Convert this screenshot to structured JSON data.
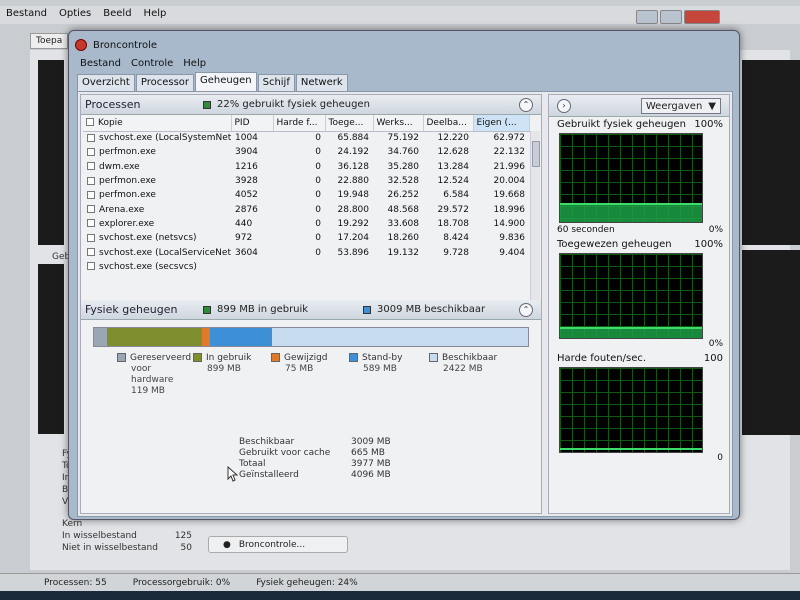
{
  "bg": {
    "menu": [
      "Bestand",
      "Opties",
      "Beeld",
      "Help"
    ],
    "tab_label": "Toepa",
    "graph_label": "Gebr",
    "left_labels": [
      "Fysi",
      "Tota",
      "In c",
      "Besc",
      "Vrij",
      "Kern"
    ],
    "rows": [
      {
        "k": "In wisselbestand",
        "v": "125"
      },
      {
        "k": "Niet in wisselbestand",
        "v": "50"
      }
    ],
    "rm_button": "Broncontrole...",
    "status": [
      "Processen: 55",
      "Processorgebruik: 0%",
      "Fysiek geheugen: 24%"
    ]
  },
  "rm": {
    "title": "Broncontrole",
    "menu": [
      "Bestand",
      "Controle",
      "Help"
    ],
    "tabs": [
      "Overzicht",
      "Processor",
      "Geheugen",
      "Schijf",
      "Netwerk"
    ],
    "active_tab": "Geheugen",
    "processes": {
      "title": "Processen",
      "badge": "22% gebruikt fysiek geheugen",
      "badge_color": "#2e8b3a",
      "columns": [
        "Kopie",
        "PID",
        "Harde f...",
        "Toege...",
        "Werks...",
        "Deelba...",
        "Eigen (..."
      ],
      "rows": [
        [
          "svchost.exe (LocalSystemNet...",
          "1004",
          "0",
          "65.884",
          "75.192",
          "12.220",
          "62.972"
        ],
        [
          "perfmon.exe",
          "3904",
          "0",
          "24.192",
          "34.760",
          "12.628",
          "22.132"
        ],
        [
          "dwm.exe",
          "1216",
          "0",
          "36.128",
          "35.280",
          "13.284",
          "21.996"
        ],
        [
          "perfmon.exe",
          "3928",
          "0",
          "22.880",
          "32.528",
          "12.524",
          "20.004"
        ],
        [
          "perfmon.exe",
          "4052",
          "0",
          "19.948",
          "26.252",
          "6.584",
          "19.668"
        ],
        [
          "Arena.exe",
          "2876",
          "0",
          "28.800",
          "48.568",
          "29.572",
          "18.996"
        ],
        [
          "explorer.exe",
          "440",
          "0",
          "19.292",
          "33.608",
          "18.708",
          "14.900"
        ],
        [
          "svchost.exe (netsvcs)",
          "972",
          "0",
          "17.204",
          "18.260",
          "8.424",
          "9.836"
        ],
        [
          "svchost.exe (LocalServiceNet...",
          "3604",
          "0",
          "53.896",
          "19.132",
          "9.728",
          "9.404"
        ],
        [
          "svchost.exe (secsvcs)",
          "",
          "",
          "",
          "",
          "",
          ""
        ]
      ]
    },
    "physical": {
      "title": "Fysiek geheugen",
      "in_use_badge": "899 MB in gebruik",
      "available_badge": "3009 MB beschikbaar",
      "bar_mb": {
        "reserved": 119,
        "in_use": 899,
        "modified": 75,
        "standby": 589,
        "free": 2422
      },
      "legend": [
        {
          "label": "Gereserveerd voor hardware",
          "lines": [
            "Gereserveerd",
            "voor",
            "hardware"
          ],
          "value": "119 MB",
          "color": "#9aa6b4"
        },
        {
          "label": "In gebruik",
          "lines": [
            "In gebruik"
          ],
          "value": "899 MB",
          "color": "#7f8f2f"
        },
        {
          "label": "Gewijzigd",
          "lines": [
            "Gewijzigd"
          ],
          "value": "75 MB",
          "color": "#e07a2a"
        },
        {
          "label": "Stand-by",
          "lines": [
            "Stand-by"
          ],
          "value": "589 MB",
          "color": "#3d8fd6"
        },
        {
          "label": "Beschikbaar",
          "lines": [
            "Beschikbaar"
          ],
          "value": "2422 MB",
          "color": "#c8dcf0"
        }
      ],
      "summary": [
        {
          "k": "Beschikbaar",
          "v": "3009 MB"
        },
        {
          "k": "Gebruikt voor cache",
          "v": "665 MB"
        },
        {
          "k": "Totaal",
          "v": "3977 MB"
        },
        {
          "k": "Geïnstalleerd",
          "v": "4096 MB"
        }
      ]
    },
    "right": {
      "views_label": "Weergaven",
      "graphs": [
        {
          "title": "Gebruikt fysiek geheugen",
          "max": "100%",
          "min": "0%",
          "foot_left": "60 seconden",
          "level": 0.22
        },
        {
          "title": "Toegewezen geheugen",
          "max": "100%",
          "min": "0%",
          "foot_left": "",
          "level": 0.13
        },
        {
          "title": "Harde fouten/sec.",
          "max": "100",
          "min": "0",
          "foot_left": "",
          "level": 0.0
        }
      ]
    }
  }
}
